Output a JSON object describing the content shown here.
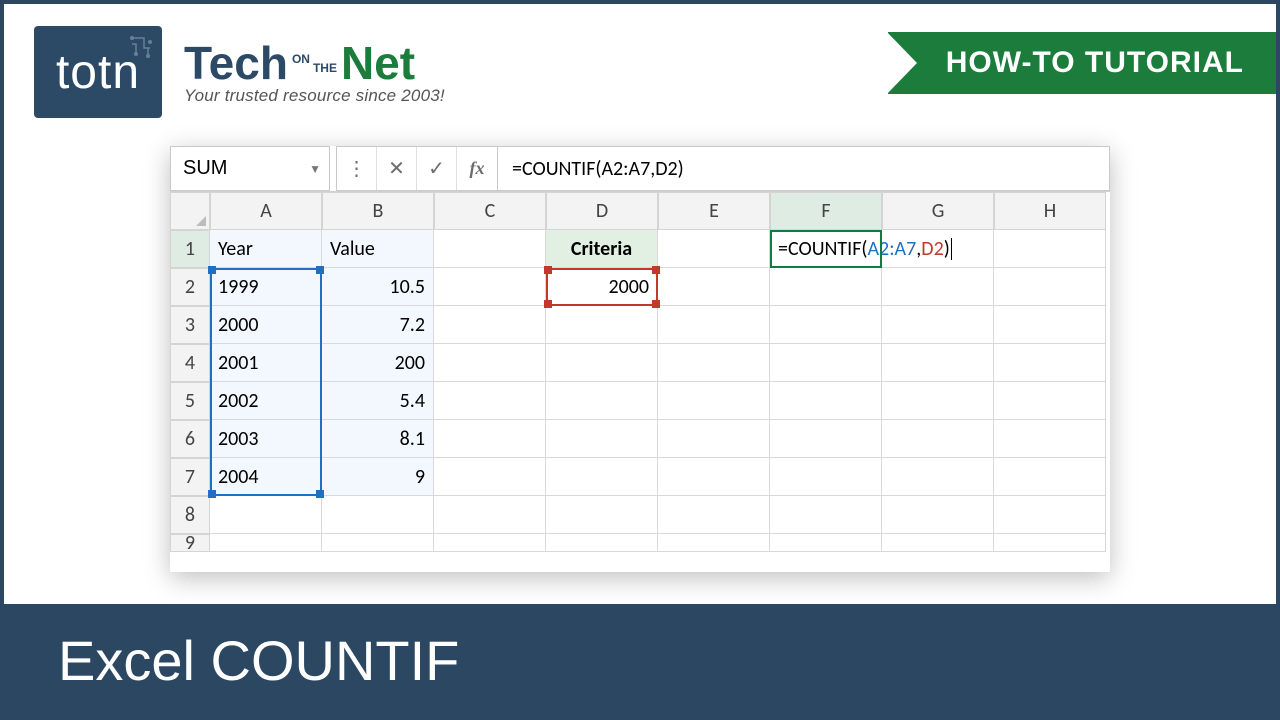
{
  "brand": {
    "logo_abbrev": "totn",
    "word_tech": "Tech",
    "word_on": "ON",
    "word_the": "THE",
    "word_net": "Net",
    "tagline": "Your trusted resource since 2003!"
  },
  "ribbon_label": "HOW-TO TUTORIAL",
  "footer_title": "Excel COUNTIF",
  "formula_bar": {
    "name_box": "SUM",
    "formula_text": "=COUNTIF(A2:A7,D2)"
  },
  "columns": [
    "A",
    "B",
    "C",
    "D",
    "E",
    "F",
    "G",
    "H"
  ],
  "rows": [
    "1",
    "2",
    "3",
    "4",
    "5",
    "6",
    "7",
    "8",
    "9"
  ],
  "headers": {
    "A1": "Year",
    "B1": "Value",
    "D1": "Criteria"
  },
  "data": {
    "years": [
      "1999",
      "2000",
      "2001",
      "2002",
      "2003",
      "2004"
    ],
    "values": [
      "10.5",
      "7.2",
      "200",
      "5.4",
      "8.1",
      "9"
    ],
    "criteria_value": "2000"
  },
  "cell_formula": {
    "prefix": "=COUNTIF(",
    "range": "A2:A7",
    "sep": ",",
    "arg2": "D2",
    "suffix": ")"
  }
}
